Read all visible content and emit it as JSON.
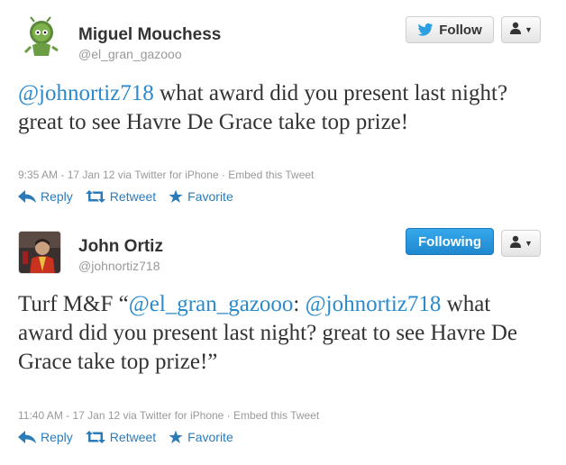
{
  "tweets": [
    {
      "name": "Miguel Mouchess",
      "handle": "@el_gran_gazooo",
      "follow_label": "Follow",
      "text_mention": "@johnortiz718",
      "text_rest": " what award did you present last night? great to see Havre De Grace take top prize!",
      "meta": "9:35 AM - 17 Jan 12 via Twitter for iPhone · Embed this Tweet",
      "actions": {
        "reply": "Reply",
        "retweet": "Retweet",
        "favorite": "Favorite"
      }
    },
    {
      "name": "John Ortiz",
      "handle": "@johnortiz718",
      "follow_label": "Following",
      "text_prefix": "Turf M&F “",
      "text_mention1": "@el_gran_gazooo",
      "text_sep": ": ",
      "text_mention2": "@johnortiz718",
      "text_rest": " what award did you present last night? great to see Havre De Grace take top prize!”",
      "meta": "11:40 AM - 17 Jan 12 via Twitter for iPhone · Embed this Tweet",
      "actions": {
        "reply": "Reply",
        "retweet": "Retweet",
        "favorite": "Favorite"
      }
    }
  ],
  "colors": {
    "link": "#2b8acb",
    "action": "#2b7bb9",
    "following_button": "#2a9be0",
    "muted": "#999999"
  },
  "icons": [
    "twitter-bird-icon",
    "user-icon",
    "chevron-down-icon",
    "reply-icon",
    "retweet-icon",
    "favorite-star-icon"
  ]
}
